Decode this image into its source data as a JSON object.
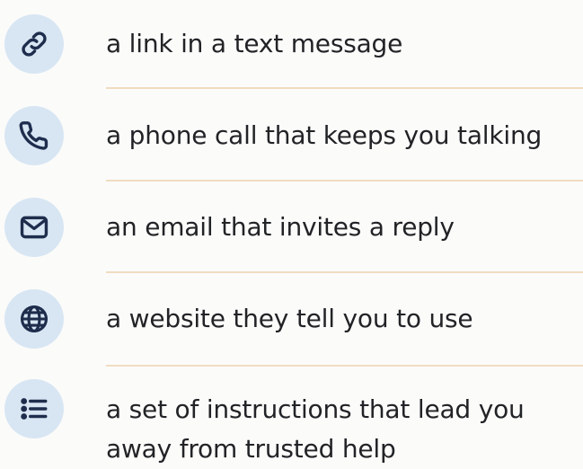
{
  "items": [
    {
      "icon": "link-icon",
      "label": "a link in a text message"
    },
    {
      "icon": "phone-icon",
      "label": "a phone call that keeps you talking"
    },
    {
      "icon": "envelope-icon",
      "label": "an email that invites a reply"
    },
    {
      "icon": "globe-icon",
      "label": "a website they tell you to use"
    },
    {
      "icon": "list-icon",
      "label": "a set of instructions that lead you away from trusted help"
    }
  ],
  "colors": {
    "icon_background": "#d8e6f3",
    "icon_stroke": "#1f2d4d",
    "divider": "#f0dcc0",
    "text": "#222326",
    "page_background": "#fbfbfa"
  }
}
